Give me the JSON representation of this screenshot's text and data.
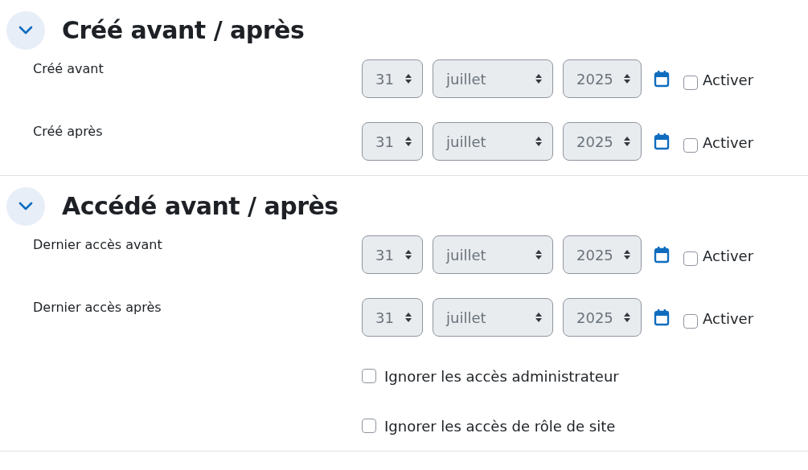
{
  "sections": [
    {
      "title": "Créé avant / après",
      "expanded": true,
      "rows": [
        {
          "label": "Créé avant",
          "day": "31",
          "month": "juillet",
          "year": "2025",
          "enabled": false,
          "enable_label": "Activer"
        },
        {
          "label": "Créé après",
          "day": "31",
          "month": "juillet",
          "year": "2025",
          "enabled": false,
          "enable_label": "Activer"
        }
      ]
    },
    {
      "title": "Accédé avant / après",
      "expanded": true,
      "rows": [
        {
          "label": "Dernier accès avant",
          "day": "31",
          "month": "juillet",
          "year": "2025",
          "enabled": false,
          "enable_label": "Activer"
        },
        {
          "label": "Dernier accès après",
          "day": "31",
          "month": "juillet",
          "year": "2025",
          "enabled": false,
          "enable_label": "Activer"
        }
      ],
      "options": [
        {
          "label": "Ignorer les accès administrateur",
          "checked": false
        },
        {
          "label": "Ignorer les accès de rôle de site",
          "checked": false
        }
      ]
    }
  ]
}
